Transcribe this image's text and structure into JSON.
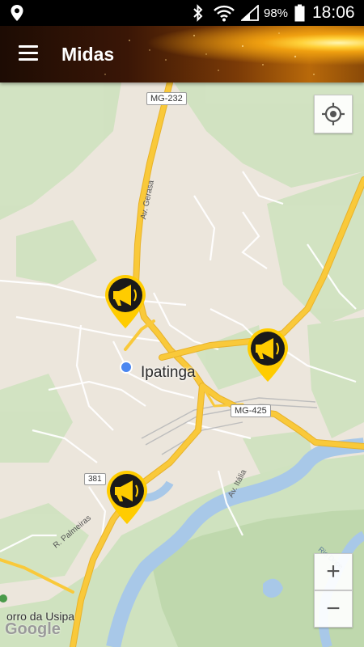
{
  "status": {
    "battery": "98%",
    "time": "18:06"
  },
  "app": {
    "title": "Midas"
  },
  "map": {
    "city_label": "Ipatinga",
    "roads": {
      "mg232": "MG-232",
      "mg425": "MG-425",
      "br381": "381"
    },
    "streets": {
      "av_gerasa": "Av. Gerasa",
      "av_italia": "Av. Itália",
      "r_palmeiras": "R. Palmeiras",
      "rio_doce": "Rio Doce"
    },
    "places": {
      "morro_usipa": "orro da Usipa"
    },
    "attribution": "Google",
    "zoom_in_label": "+",
    "zoom_out_label": "−"
  },
  "markers": [
    {
      "name": "megaphone-marker-1"
    },
    {
      "name": "megaphone-marker-2"
    },
    {
      "name": "megaphone-marker-3"
    }
  ],
  "colors": {
    "marker": "#ffcc00",
    "marker_ring": "#1a1a1a",
    "road": "#f9c93a",
    "water": "#a8c8e8",
    "park": "#cfe2bf",
    "location": "#4a86f0"
  }
}
